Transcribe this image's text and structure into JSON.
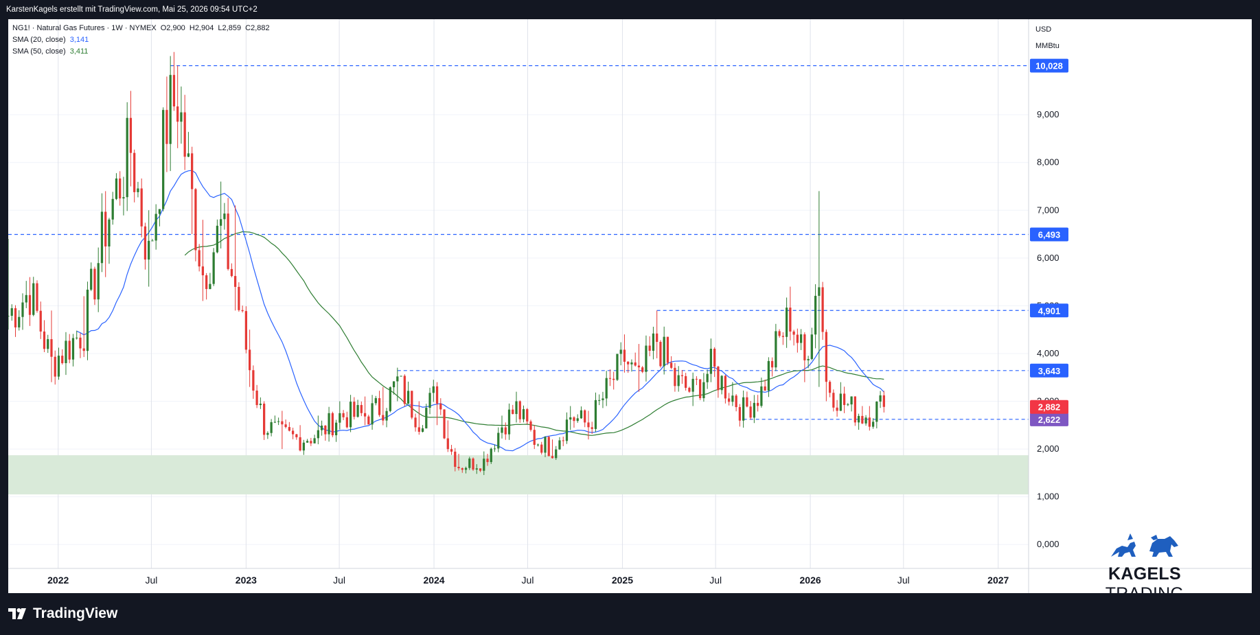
{
  "header": {
    "byline": "KarstenKagels erstellt mit TradingView.com, Mai 25, 2026 09:54 UTC+2"
  },
  "legend": {
    "symbol": "NG1! · Natural Gas Futures · 1W · NYMEX",
    "ohlc": {
      "open": "O2,900",
      "high": "H2,904",
      "low": "L2,859",
      "close": "C2,882"
    },
    "sma20_label": "SMA (20, close)",
    "sma20_value": "3,141",
    "sma50_label": "SMA (50, close)",
    "sma50_value": "3,411"
  },
  "axis": {
    "currency": "USD",
    "unit": "MMBtu"
  },
  "branding": {
    "watermark_strong": "KAGELS",
    "watermark_light": " TRADING",
    "footer_logo": "TradingView"
  },
  "colors": {
    "up": "#26a69a",
    "up_body": "#2e7d32",
    "down": "#ef5350",
    "down_body": "#e53935",
    "sma20": "#2962ff",
    "sma50": "#2e7d32",
    "hline": "#2962ff",
    "zone": "#d9ead9",
    "last_price": "#f23645",
    "support_badge": "#7e57c2"
  },
  "chart_data": {
    "type": "candlestick",
    "interval": "1W",
    "y_ticks": [
      "0,000",
      "1,000",
      "2,000",
      "3,000",
      "4,000",
      "5,000",
      "6,000",
      "7,000",
      "8,000",
      "9,000"
    ],
    "ylim": [
      -0.5,
      11.0
    ],
    "x_ticks": [
      {
        "label": "2022",
        "date": "2022-01-01",
        "bold": true
      },
      {
        "label": "Jul",
        "date": "2022-07-01",
        "bold": false
      },
      {
        "label": "2023",
        "date": "2023-01-01",
        "bold": true
      },
      {
        "label": "Jul",
        "date": "2023-07-01",
        "bold": false
      },
      {
        "label": "2024",
        "date": "2024-01-01",
        "bold": true
      },
      {
        "label": "Jul",
        "date": "2024-07-01",
        "bold": false
      },
      {
        "label": "2025",
        "date": "2025-01-01",
        "bold": true
      },
      {
        "label": "Jul",
        "date": "2025-07-01",
        "bold": false
      },
      {
        "label": "2026",
        "date": "2026-01-01",
        "bold": true
      },
      {
        "label": "Jul",
        "date": "2026-07-01",
        "bold": false
      },
      {
        "label": "2027",
        "date": "2027-01-01",
        "bold": true
      }
    ],
    "x_range": [
      "2021-09-26",
      "2027-03-01"
    ],
    "horizontal_levels": [
      {
        "value": 10.028,
        "label": "10,028",
        "from": "2022-08-07"
      },
      {
        "value": 6.493,
        "label": "6,493",
        "from": "start"
      },
      {
        "value": 4.901,
        "label": "4,901",
        "from": "2025-03-09"
      },
      {
        "value": 3.643,
        "label": "3,643",
        "from": "2023-10-22"
      },
      {
        "value": 2.622,
        "label": "2,622",
        "from": "2025-08-24"
      }
    ],
    "last_price": {
      "value": 2.882,
      "label": "2,882"
    },
    "support_zone": {
      "low": 1.05,
      "high": 1.87
    },
    "ohlc_anchor": [
      [
        "2021-09-26",
        4.8,
        6.4,
        4.5
      ],
      [
        "2021-11-07",
        5.3,
        5.6,
        4.8
      ],
      [
        "2021-12-19",
        3.8,
        4.9,
        3.4
      ],
      [
        "2022-02-20",
        4.5,
        5.2,
        4.0
      ],
      [
        "2022-04-03",
        6.7,
        7.4,
        5.6
      ],
      [
        "2022-05-22",
        8.3,
        9.5,
        7.5
      ],
      [
        "2022-06-26",
        6.0,
        7.0,
        5.4
      ],
      [
        "2022-07-31",
        8.9,
        9.8,
        7.8
      ],
      [
        "2022-08-21",
        9.4,
        10.028,
        8.3
      ],
      [
        "2022-09-18",
        7.2,
        8.0,
        6.5
      ],
      [
        "2022-10-09",
        5.7,
        6.8,
        5.1
      ],
      [
        "2022-11-13",
        6.6,
        7.6,
        6.2
      ],
      [
        "2022-12-11",
        5.4,
        7.1,
        4.9
      ],
      [
        "2023-01-08",
        3.7,
        4.5,
        3.3
      ],
      [
        "2023-02-05",
        2.5,
        3.0,
        2.2
      ],
      [
        "2023-03-12",
        2.3,
        2.8,
        2.0
      ],
      [
        "2023-04-16",
        2.2,
        2.5,
        1.95
      ],
      [
        "2023-05-21",
        2.3,
        2.7,
        2.1
      ],
      [
        "2023-07-02",
        2.7,
        3.0,
        2.5
      ],
      [
        "2023-08-20",
        2.7,
        3.1,
        2.5
      ],
      [
        "2023-09-24",
        2.9,
        3.3,
        2.7
      ],
      [
        "2023-10-22",
        3.4,
        3.643,
        3.0
      ],
      [
        "2023-12-03",
        2.6,
        3.0,
        2.3
      ],
      [
        "2024-01-07",
        3.2,
        3.4,
        2.5
      ],
      [
        "2024-01-28",
        2.1,
        2.6,
        1.95
      ],
      [
        "2024-02-18",
        1.65,
        1.9,
        1.55
      ],
      [
        "2024-04-07",
        1.75,
        1.95,
        1.6
      ],
      [
        "2024-05-12",
        2.5,
        2.7,
        2.3
      ],
      [
        "2024-06-09",
        2.85,
        3.2,
        2.6
      ],
      [
        "2024-07-14",
        2.2,
        2.5,
        2.0
      ],
      [
        "2024-08-18",
        2.0,
        2.2,
        1.88
      ],
      [
        "2024-09-22",
        2.7,
        2.9,
        2.4
      ],
      [
        "2024-10-27",
        2.5,
        2.8,
        2.2
      ],
      [
        "2024-12-01",
        3.2,
        3.4,
        2.9
      ],
      [
        "2025-01-05",
        3.9,
        4.4,
        3.6
      ],
      [
        "2025-02-02",
        3.4,
        4.2,
        3.2
      ],
      [
        "2025-03-09",
        4.3,
        4.901,
        3.9
      ],
      [
        "2025-04-13",
        3.4,
        3.8,
        3.2
      ],
      [
        "2025-05-18",
        3.2,
        3.6,
        2.9
      ],
      [
        "2025-06-22",
        3.7,
        4.1,
        3.4
      ],
      [
        "2025-08-03",
        3.1,
        3.4,
        2.9
      ],
      [
        "2025-08-24",
        2.8,
        3.0,
        2.622
      ],
      [
        "2025-09-28",
        3.2,
        3.4,
        2.9
      ],
      [
        "2025-10-26",
        4.1,
        4.4,
        3.8
      ],
      [
        "2025-11-23",
        4.8,
        5.4,
        4.5
      ],
      [
        "2025-12-21",
        3.8,
        4.3,
        3.4
      ],
      [
        "2026-01-18",
        5.7,
        7.4,
        3.3
      ],
      [
        "2026-02-01",
        3.4,
        4.0,
        3.0
      ],
      [
        "2026-03-01",
        3.0,
        3.4,
        2.8
      ],
      [
        "2026-04-12",
        2.7,
        2.9,
        2.6
      ],
      [
        "2026-04-26",
        2.75,
        2.9,
        2.62
      ],
      [
        "2026-05-17",
        2.9,
        2.98,
        2.86
      ],
      [
        "2026-05-24",
        2.882,
        2.904,
        2.859
      ]
    ]
  }
}
